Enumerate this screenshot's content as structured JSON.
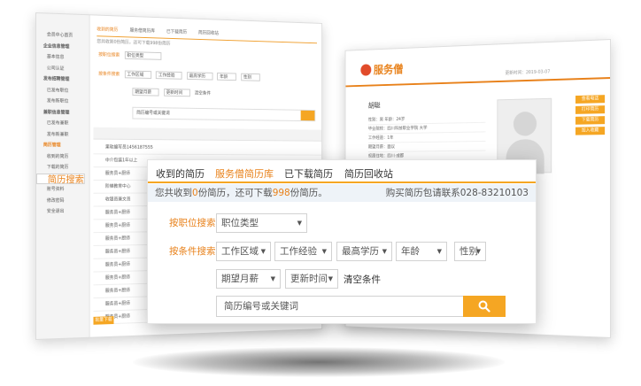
{
  "back_left": {
    "sidebar": [
      {
        "label": "会员中心首页",
        "type": "item"
      },
      {
        "label": "企业信息管理",
        "type": "grp"
      },
      {
        "label": "基本信息",
        "type": "item"
      },
      {
        "label": "公司认证",
        "type": "item"
      },
      {
        "label": "发布招聘管理",
        "type": "grp"
      },
      {
        "label": "已发布职位",
        "type": "item"
      },
      {
        "label": "发布新职位",
        "type": "item"
      },
      {
        "label": "兼职信息管理",
        "type": "grp"
      },
      {
        "label": "已发布兼职",
        "type": "item"
      },
      {
        "label": "发布新兼职",
        "type": "item"
      },
      {
        "label": "简历管理",
        "type": "grp-active"
      },
      {
        "label": "收到的简历",
        "type": "item"
      },
      {
        "label": "下载的简历",
        "type": "item"
      },
      {
        "label": "简历搜索",
        "type": "sel"
      },
      {
        "label": "管理账户信息",
        "type": "grp"
      },
      {
        "label": "账号资料",
        "type": "item"
      },
      {
        "label": "修改密码",
        "type": "item"
      },
      {
        "label": "安全退出",
        "type": "item"
      }
    ],
    "tabs": [
      "收到的简历",
      "服务僧简历库",
      "已下载简历",
      "简历回收站"
    ],
    "note": "您共收到0份简历，还可下载998份简历",
    "row1_label": "按职位搜索",
    "row1_box": "职位类型",
    "row2_label": "按条件搜索",
    "row2_boxes": [
      "工作区域",
      "工作经验",
      "最高学历",
      "年龄",
      "性别"
    ],
    "row3_boxes": [
      "期望月薪",
      "更新时间",
      "清空条件"
    ],
    "search_placeholder": "简历编号或关键词",
    "rows": [
      "果软编写员1456187555",
      "中介包装1年以上",
      "服务员+厨师",
      "阶梯教育中心",
      "收银员兼文员",
      "服务员+厨师",
      "服务员+厨师",
      "服务员+厨师",
      "服务员+厨师",
      "服务员+厨师",
      "服务员+厨师",
      "服务员+厨师",
      "服务员+厨师",
      "服务员+厨师"
    ],
    "bottom_btn": "批量下载"
  },
  "back_right": {
    "logo": "服务僧",
    "date": "更新时间：2019-03-07",
    "name": "胡聪",
    "lines": [
      "性别：男   年龄：24岁",
      "毕业院校：四川科技职业学院 大学",
      "工作经验：1年",
      "期望月薪：面议",
      "现居住地：四川·成都",
      "联系电话：2654****86",
      "联系邮箱：****@qq.com",
      "求职意向：服务员"
    ],
    "side_buttons": [
      "查看电话",
      "打印简历",
      "下载简历",
      "加入收藏"
    ]
  },
  "front": {
    "tabs": [
      "收到的简历",
      "服务僧简历库",
      "已下载简历",
      "简历回收站"
    ],
    "notice_left_pre": "您共收到",
    "notice_left_n1": "0",
    "notice_left_mid": "份简历，还可下载",
    "notice_left_n2": "998",
    "notice_left_post": "份简历。",
    "notice_right": "购买简历包请联系028-83210103",
    "job_search_label": "按职位搜索",
    "job_type": "职位类型",
    "cond_search_label": "按条件搜索",
    "work_area": "工作区域",
    "work_exp": "工作经验",
    "education": "最高学历",
    "age": "年龄",
    "gender": "性别",
    "salary": "期望月薪",
    "update_time": "更新时间",
    "clear": "清空条件",
    "search_placeholder": "简历编号或关键词"
  },
  "colors": {
    "accent": "#f5a623",
    "accent_text": "#e8811a",
    "notice_bg": "#eef3f8"
  }
}
